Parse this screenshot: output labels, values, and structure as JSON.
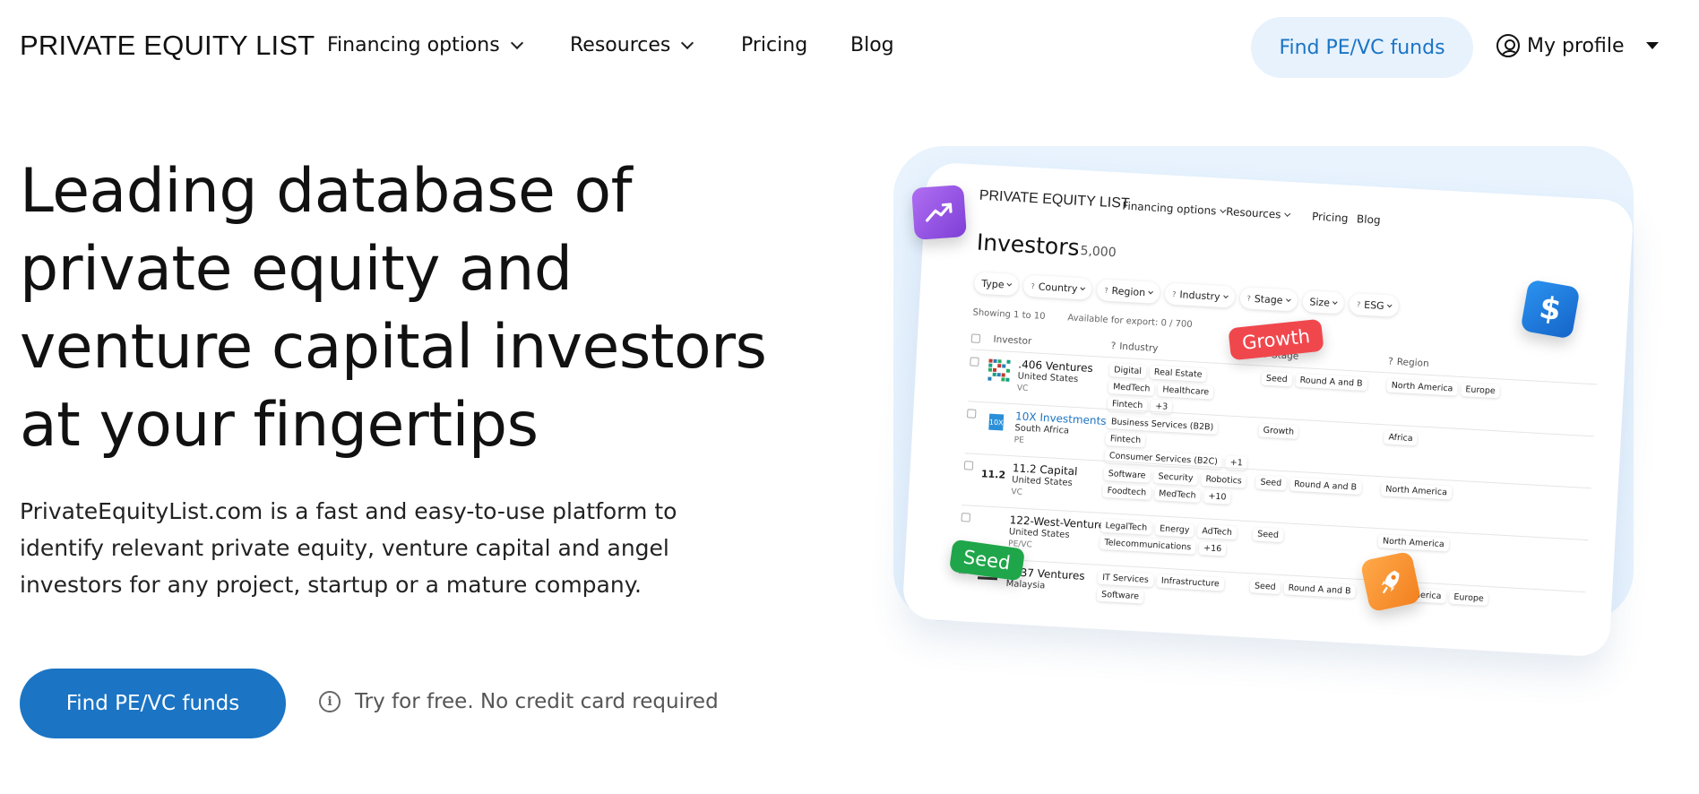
{
  "nav": {
    "logo": "PRIVATE EQUITY LIST",
    "items": [
      {
        "label": "Financing options",
        "dropdown": true
      },
      {
        "label": "Resources",
        "dropdown": true
      },
      {
        "label": "Pricing",
        "dropdown": false
      },
      {
        "label": "Blog",
        "dropdown": false
      }
    ],
    "cta": "Find PE/VC funds",
    "profile": "My profile"
  },
  "hero": {
    "title": "Leading database of private equity and venture capital investors at your fingertips",
    "description": "PrivateEquityList.com is a fast and easy-to-use platform to identify relevant private equity, venture capital and angel investors for any project, startup or a mature company.",
    "cta": "Find PE/VC funds",
    "note": "Try for free. No credit card required"
  },
  "mockup": {
    "logo": "PRIVATE EQUITY LIST",
    "nav": [
      "Financing options",
      "Resources",
      "Pricing",
      "Blog"
    ],
    "title": "Investors",
    "count": "5,000",
    "filters": [
      {
        "label": "Type",
        "q": false
      },
      {
        "label": "Country",
        "q": true
      },
      {
        "label": "Region",
        "q": true
      },
      {
        "label": "Industry",
        "q": true
      },
      {
        "label": "Stage",
        "q": true
      },
      {
        "label": "Size",
        "q": false
      },
      {
        "label": "ESG",
        "q": true
      }
    ],
    "showing": "Showing 1 to 10",
    "export": "Available for export: 0 / 700",
    "columns": {
      "investor": "Investor",
      "industry": "Industry",
      "stage": "Stage",
      "region": "Region"
    },
    "rows": [
      {
        "name": ".406 Ventures",
        "country": "United States",
        "type": "VC",
        "logo": "",
        "industry": [
          "Digital",
          "Real Estate",
          "MedTech",
          "Healthcare",
          "Fintech",
          "+3"
        ],
        "stage": [
          "Seed",
          "Round A and B"
        ],
        "region": [
          "North America",
          "Europe"
        ]
      },
      {
        "name": "10X Investments",
        "country": "South Africa",
        "type": "PE",
        "logo": "10X",
        "industry": [
          "Business Services (B2B)",
          "Fintech",
          "Consumer Services (B2C)",
          "+1"
        ],
        "stage": [
          "Growth"
        ],
        "region": [
          "Africa"
        ]
      },
      {
        "name": "11.2 Capital",
        "country": "United States",
        "type": "VC",
        "logo": "11.2",
        "industry": [
          "Software",
          "Security",
          "Robotics",
          "Foodtech",
          "MedTech",
          "+10"
        ],
        "stage": [
          "Seed",
          "Round A and B"
        ],
        "region": [
          "North America"
        ]
      },
      {
        "name": "122-West-Ventures",
        "country": "United States",
        "type": "PE/VC",
        "logo": "",
        "industry": [
          "LegalTech",
          "Energy",
          "AdTech",
          "Telecommunications",
          "+16"
        ],
        "stage": [
          "Seed"
        ],
        "region": [
          "North America"
        ]
      },
      {
        "name": "1337 Ventures",
        "country": "Malaysia",
        "type": "",
        "logo": "",
        "industry": [
          "IT Services",
          "Infrastructure",
          "Software"
        ],
        "stage": [
          "Seed",
          "Round A and B"
        ],
        "region": [
          "North America",
          "Europe"
        ]
      }
    ],
    "badges": {
      "growth": "Growth",
      "seed": "Seed"
    },
    "colors": {
      "growth": "#f0474d",
      "seed": "#1fa64a",
      "chart": "#9b59e8",
      "dollar": "#1c7de0",
      "rocket": "#f7932f"
    }
  }
}
